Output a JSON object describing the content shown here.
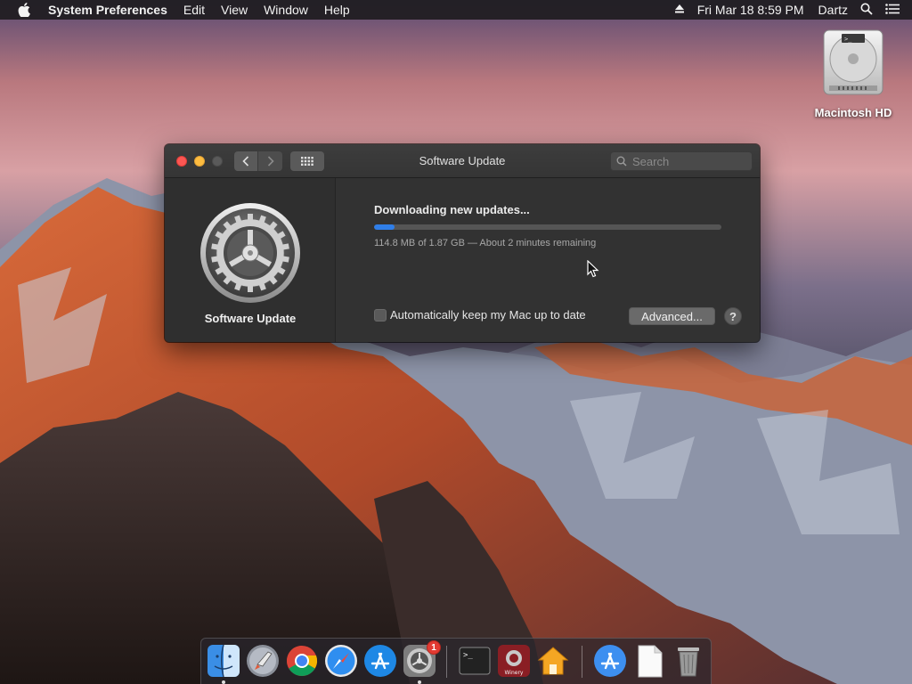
{
  "menubar": {
    "app_name": "System Preferences",
    "items": [
      "Edit",
      "View",
      "Window",
      "Help"
    ],
    "clock": "Fri Mar 18  8:59 PM",
    "user": "Dartz"
  },
  "desktop": {
    "icons": [
      {
        "label": "Macintosh HD",
        "icon": "hard-drive-icon"
      }
    ]
  },
  "window": {
    "title": "Software Update",
    "search_placeholder": "Search",
    "sidebar_label": "Software Update",
    "status_title": "Downloading new updates...",
    "progress_fraction": 0.06,
    "progress_detail": "114.8 MB of 1.87 GB — About 2 minutes remaining",
    "auto_update_label": "Automatically keep my Mac up to date",
    "auto_update_checked": false,
    "advanced_button": "Advanced...",
    "help_button": "?"
  },
  "dock": {
    "items": [
      {
        "name": "finder",
        "icon": "finder-icon",
        "running": true
      },
      {
        "name": "launchpad",
        "icon": "rocket-icon",
        "running": false
      },
      {
        "name": "chrome",
        "icon": "chrome-icon",
        "running": false
      },
      {
        "name": "safari",
        "icon": "compass-icon",
        "running": false
      },
      {
        "name": "app-store",
        "icon": "app-store-icon",
        "running": false
      },
      {
        "name": "system-preferences",
        "icon": "gear-icon",
        "running": true,
        "badge": "1"
      },
      {
        "name": "terminal",
        "icon": "terminal-icon",
        "running": false
      },
      {
        "name": "winery",
        "icon": "winery-icon",
        "running": false,
        "label": "Winery"
      },
      {
        "name": "home",
        "icon": "home-icon",
        "running": false
      },
      {
        "name": "applications",
        "icon": "app-store-icon",
        "running": false
      },
      {
        "name": "document",
        "icon": "document-icon",
        "running": false
      },
      {
        "name": "trash",
        "icon": "trash-icon",
        "running": false
      }
    ]
  },
  "colors": {
    "accent": "#2f7ee8",
    "close": "#fc5753",
    "minimize": "#fdbc40",
    "badge": "#e23a32"
  }
}
